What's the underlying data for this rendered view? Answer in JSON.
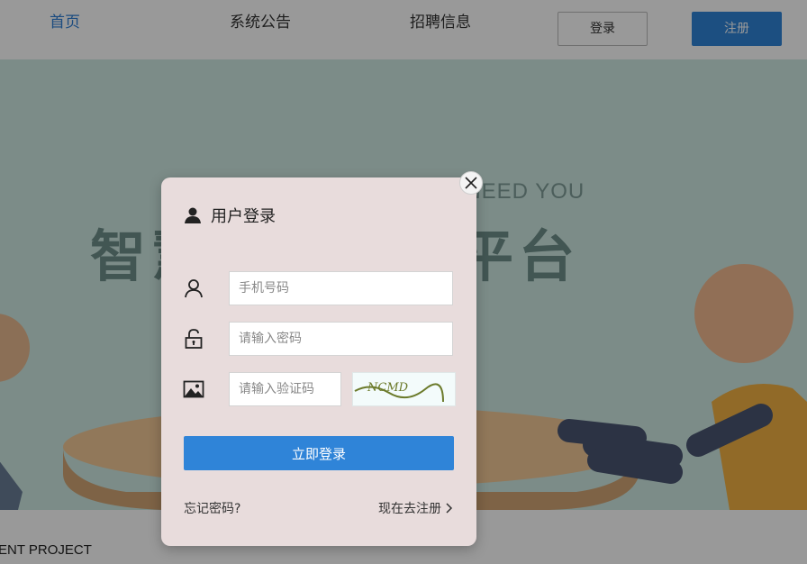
{
  "nav": {
    "home": "首页",
    "notice": "系统公告",
    "jobs": "招聘信息",
    "login": "登录",
    "register": "注册"
  },
  "banner": {
    "tagline": "WE NEED YOU",
    "title": "智慧教师招聘平台"
  },
  "footer": {
    "project_text": "ENT PROJECT"
  },
  "modal": {
    "title": "用户登录",
    "phone_placeholder": "手机号码",
    "password_placeholder": "请输入密码",
    "captcha_placeholder": "请输入验证码",
    "captcha_text": "NCMD",
    "submit": "立即登录",
    "forgot": "忘记密码?",
    "register": "现在去注册"
  },
  "colors": {
    "accent": "#2f84d8",
    "active_nav": "#2f7fd6",
    "modal_bg": "#e8dcdc"
  },
  "icons": {
    "title": "user-silhouette-icon",
    "phone": "user-outline-icon",
    "password": "lock-icon",
    "captcha": "image-icon",
    "close": "close-icon",
    "register": "chevron-right-icon"
  }
}
